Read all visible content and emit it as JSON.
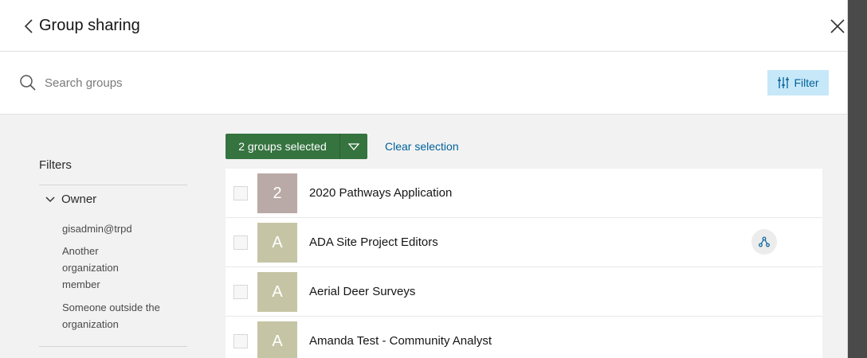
{
  "header": {
    "title": "Group sharing"
  },
  "search": {
    "placeholder": "Search groups"
  },
  "filter_button": {
    "label": "Filter"
  },
  "sidebar": {
    "title": "Filters",
    "section": {
      "label": "Owner"
    },
    "options": [
      {
        "label": "gisadmin@trpd"
      },
      {
        "label": "Another organization member"
      },
      {
        "label": "Someone outside the organization"
      }
    ]
  },
  "selection": {
    "label": "2 groups selected",
    "clear_label": "Clear selection"
  },
  "groups": [
    {
      "initial": "2",
      "name": "2020 Pathways Application",
      "color": "#b9a9a7",
      "has_icon": false
    },
    {
      "initial": "A",
      "name": "ADA Site Project Editors",
      "color": "#c5c5a6",
      "has_icon": true
    },
    {
      "initial": "A",
      "name": "Aerial Deer Surveys",
      "color": "#c5c5a6",
      "has_icon": false
    },
    {
      "initial": "A",
      "name": "Amanda Test - Community Analyst",
      "color": "#c5c5a6",
      "has_icon": false
    }
  ],
  "colors": {
    "accent_green": "#35733f",
    "link_blue": "#00619b",
    "filter_bg": "#c7e8f8"
  }
}
